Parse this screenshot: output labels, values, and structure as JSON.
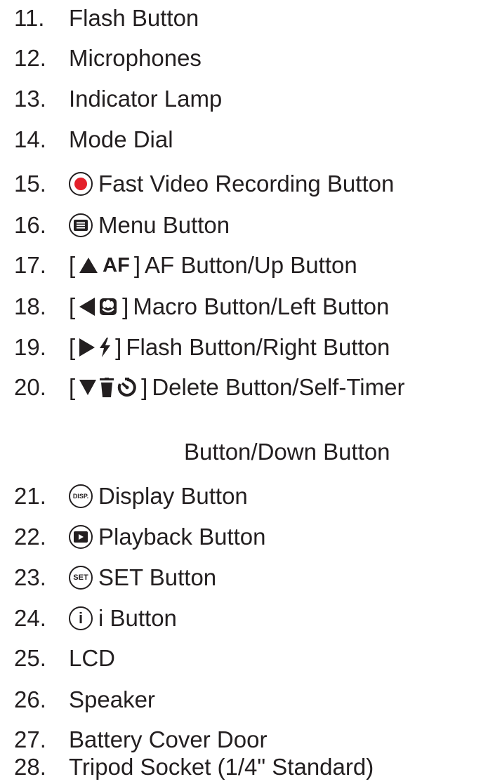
{
  "items": [
    {
      "num": "11.",
      "label": "Flash Button"
    },
    {
      "num": "12.",
      "label": "Microphones"
    },
    {
      "num": "13.",
      "label": "Indicator Lamp"
    },
    {
      "num": "14.",
      "label": "Mode Dial"
    },
    {
      "num": "15.",
      "label": "Fast Video Recording Button",
      "icon": "record-icon"
    },
    {
      "num": "16.",
      "label": "Menu Button",
      "icon": "menu-icon"
    },
    {
      "num": "17.",
      "label": "AF Button/Up Button",
      "icon_glyphs": "[▲AF]",
      "af_text": "AF"
    },
    {
      "num": "18.",
      "label": "Macro Button/Left Button",
      "icon_glyphs": "[◀ macro]"
    },
    {
      "num": "19.",
      "label": "Flash Button/Right Button",
      "icon_glyphs": "[▶ flash]"
    },
    {
      "num": "20.",
      "label": "Delete Button/Self-Timer",
      "label_cont": "Button/Down Button",
      "icon_glyphs": "[▼ delete self-timer]"
    },
    {
      "num": "21.",
      "label": "Display Button",
      "icon_text": "DISP."
    },
    {
      "num": "22.",
      "label": "Playback Button",
      "icon": "playback-icon"
    },
    {
      "num": "23.",
      "label": "SET Button",
      "icon_text": "SET"
    },
    {
      "num": "24.",
      "label": "i Button",
      "icon_text": "i"
    },
    {
      "num": "25.",
      "label": "LCD"
    },
    {
      "num": "26.",
      "label": "Speaker"
    },
    {
      "num": "27.",
      "label": "Battery Cover Door"
    },
    {
      "num": "28.",
      "label": "Tripod Socket (1/4\" Standard)"
    }
  ]
}
